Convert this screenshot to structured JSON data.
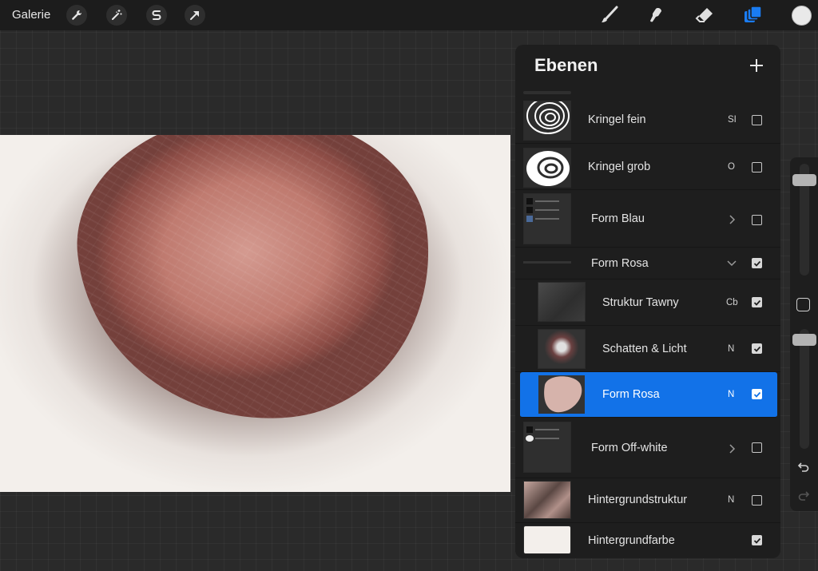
{
  "toolbar": {
    "gallery_label": "Galerie",
    "left_icons": [
      "wrench-icon",
      "magic-wand-icon",
      "selection-s-icon",
      "transform-arrow-icon"
    ],
    "right_icons": [
      "brush-icon",
      "smudge-icon",
      "eraser-icon",
      "layers-icon"
    ],
    "accent_color": "#1a7cf2",
    "current_color": "#e9e9e9"
  },
  "layers_panel": {
    "title": "Ebenen",
    "add_icon": "plus-icon",
    "layers": [
      {
        "name": "Kringel fein",
        "blend": "SI",
        "visible": false,
        "type": "layer"
      },
      {
        "name": "Kringel grob",
        "blend": "O",
        "visible": false,
        "type": "layer"
      },
      {
        "name": "Form Blau",
        "blend": "",
        "visible": false,
        "type": "group-collapsed"
      },
      {
        "name": "Form Rosa",
        "blend": "",
        "visible": true,
        "type": "group-expanded"
      },
      {
        "name": "Struktur Tawny",
        "blend": "Cb",
        "visible": true,
        "type": "child"
      },
      {
        "name": "Schatten & Licht",
        "blend": "N",
        "visible": true,
        "type": "child"
      },
      {
        "name": "Form Rosa",
        "blend": "N",
        "visible": true,
        "type": "child-selected"
      },
      {
        "name": "Form Off-white",
        "blend": "",
        "visible": false,
        "type": "group-collapsed"
      },
      {
        "name": "Hintergrundstruktur",
        "blend": "N",
        "visible": false,
        "type": "layer"
      },
      {
        "name": "Hintergrundfarbe",
        "blend": "",
        "visible": true,
        "type": "background"
      }
    ]
  },
  "sidebar": {
    "undo_icon": "undo-icon",
    "redo_icon": "redo-icon",
    "modify_icon": "square-modify-icon"
  }
}
